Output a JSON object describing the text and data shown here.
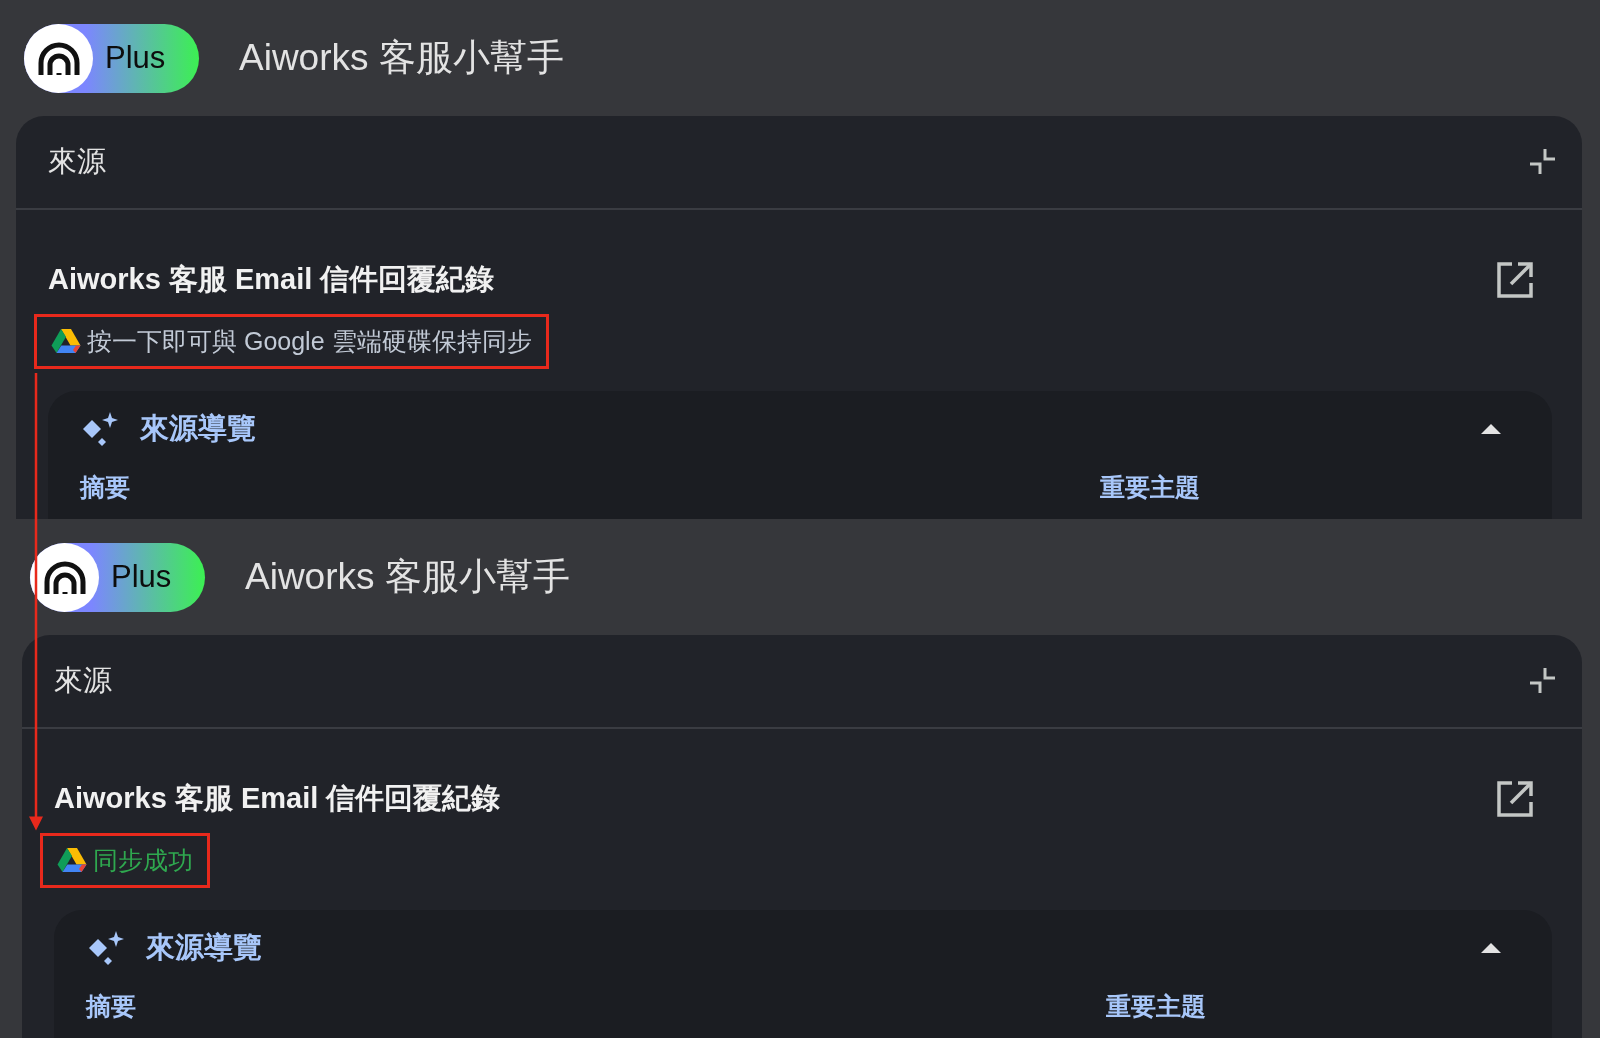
{
  "panels": [
    {
      "logo_badge": "Plus",
      "app_title": "Aiworks 客服小幫手",
      "sources_heading": "來源",
      "source": {
        "title": "Aiworks 客服 Email 信件回覆紀錄",
        "sync_status": {
          "kind": "prompt",
          "text": "按一下即可與 Google 雲端硬碟保持同步",
          "highlighted": true
        }
      },
      "overview": {
        "title": "來源導覽",
        "expanded": true,
        "columns": [
          "摘要",
          "重要主題"
        ]
      }
    },
    {
      "logo_badge": "Plus",
      "app_title": "Aiworks 客服小幫手",
      "sources_heading": "來源",
      "source": {
        "title": "Aiworks 客服 Email 信件回覆紀錄",
        "sync_status": {
          "kind": "success",
          "text": "同步成功",
          "highlighted": true
        }
      },
      "overview": {
        "title": "來源導覽",
        "expanded": true,
        "columns": [
          "摘要",
          "重要主題"
        ]
      }
    }
  ],
  "annotation": {
    "kind": "arrow"
  }
}
